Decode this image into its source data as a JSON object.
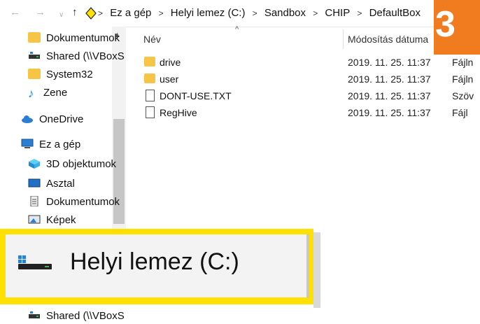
{
  "address": {
    "crumbs": [
      "Ez a gép",
      "Helyi lemez (C:)",
      "Sandbox",
      "CHIP",
      "DefaultBox"
    ]
  },
  "badge": "3",
  "sidebar": {
    "items": [
      {
        "label": "Dokumentumok",
        "icon": "folder-icon"
      },
      {
        "label": "Shared (\\\\VBoxS",
        "icon": "network-drive-icon"
      },
      {
        "label": "System32",
        "icon": "folder-icon"
      },
      {
        "label": "Zene",
        "icon": "music-icon"
      },
      {
        "label": "OneDrive",
        "icon": "cloud-icon"
      },
      {
        "label": "Ez a gép",
        "icon": "computer-icon"
      },
      {
        "label": "3D objektumok",
        "icon": "cube-icon"
      },
      {
        "label": "Asztal",
        "icon": "desktop-icon"
      },
      {
        "label": "Dokumentumok",
        "icon": "document-icon"
      },
      {
        "label": "Képek",
        "icon": "picture-icon"
      },
      {
        "label": "Shared (\\\\VBoxS",
        "icon": "network-drive-icon"
      }
    ]
  },
  "headers": {
    "name": "Név",
    "modified": "Módosítás dátuma"
  },
  "files": [
    {
      "name": "drive",
      "date": "2019. 11. 25. 11:37",
      "type": "Fájln",
      "icon": "folder-icon"
    },
    {
      "name": "user",
      "date": "2019. 11. 25. 11:37",
      "type": "Fájln",
      "icon": "folder-icon"
    },
    {
      "name": "DONT-USE.TXT",
      "date": "2019. 11. 25. 11:37",
      "type": "Szöv",
      "icon": "text-file-icon"
    },
    {
      "name": "RegHive",
      "date": "2019. 11. 25. 11:37",
      "type": "Fájl",
      "icon": "file-icon"
    }
  ],
  "zoom": {
    "label": "Helyi lemez (C:)"
  },
  "colors": {
    "accent": "#f07c1f",
    "highlight": "#ffe000",
    "folder": "#f7c546"
  }
}
